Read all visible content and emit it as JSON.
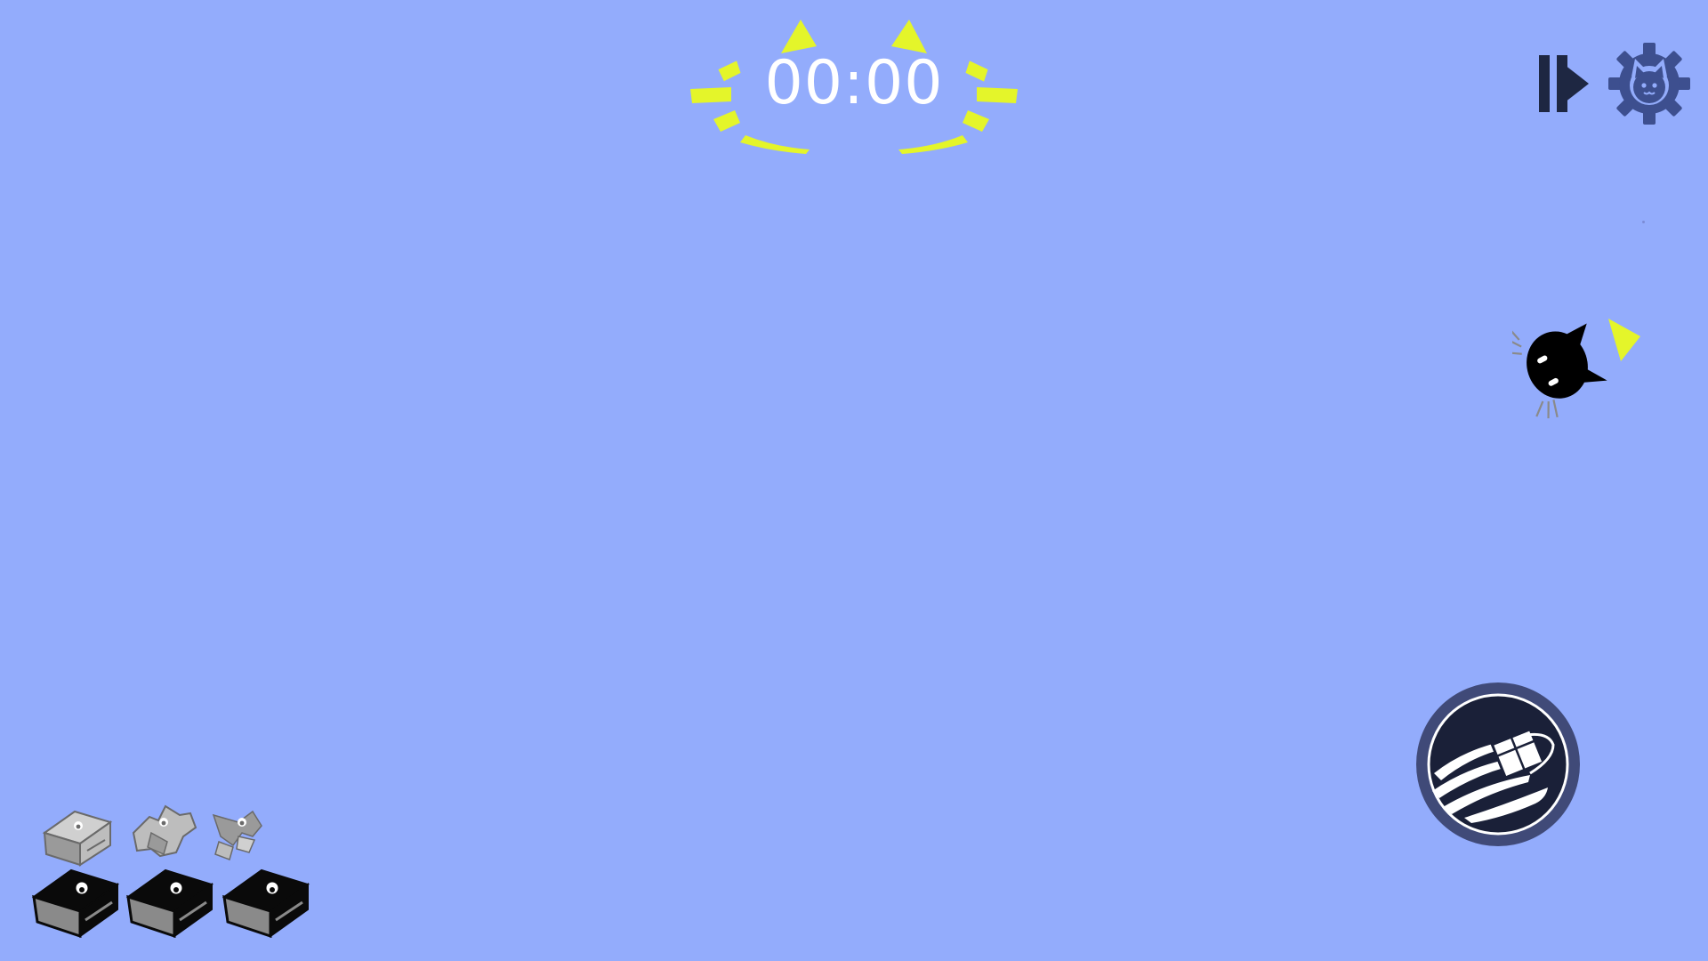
{
  "hud": {
    "timer": "00:00",
    "timer_ray_color": "#e4f52a",
    "pause_play_icon": "pause-play-icon",
    "settings_icon": "cat-gear-icon",
    "settings_color": "#3d4f8f"
  },
  "player": {
    "sprite": "black-cat-head-icon",
    "direction_indicator": "yellow-triangle-pointer",
    "indicator_color": "#e4f52a"
  },
  "ability": {
    "icon": "dashing-box-icon",
    "ring_color": "#404a78",
    "fill_color": "#1a2038"
  },
  "inventory": {
    "reserve_boxes": [
      {
        "state": "intact",
        "icon": "grey-box-icon"
      },
      {
        "state": "damaged",
        "icon": "grey-broken-box-icon"
      },
      {
        "state": "shattered",
        "icon": "grey-shattered-box-icon"
      }
    ],
    "active_boxes": [
      {
        "state": "intact",
        "icon": "black-box-icon"
      },
      {
        "state": "intact",
        "icon": "black-box-icon"
      },
      {
        "state": "intact",
        "icon": "black-box-icon"
      }
    ]
  },
  "colors": {
    "background": "#93acfc"
  }
}
